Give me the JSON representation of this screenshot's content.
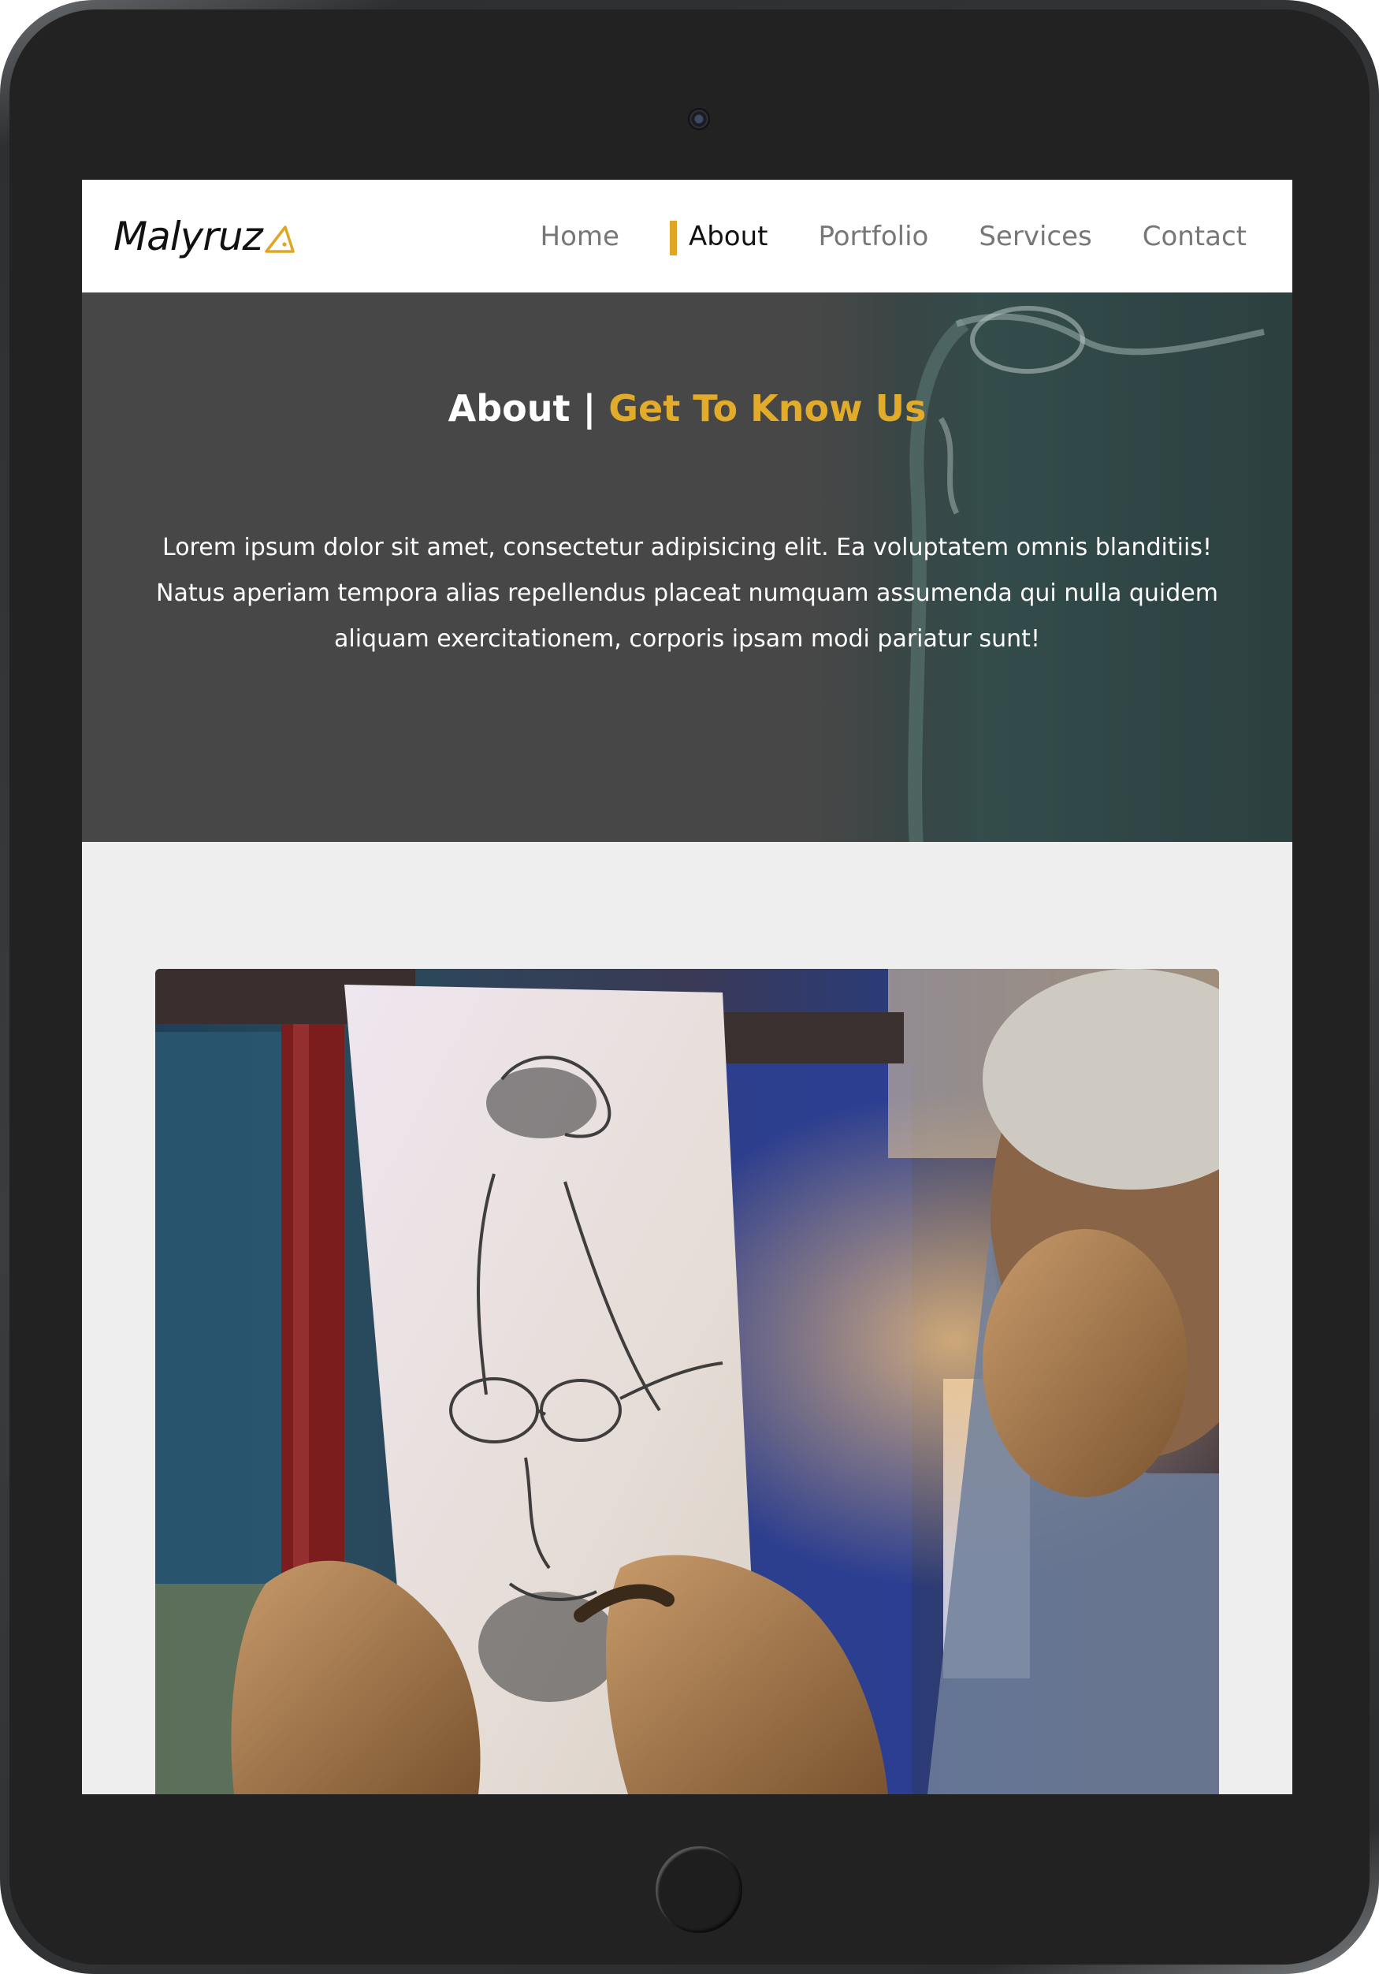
{
  "brand": {
    "name": "Malyruz",
    "logo_icon": "triangle-logo-icon",
    "accent_color": "#e0a521"
  },
  "nav": {
    "items": [
      {
        "label": "Home",
        "active": false
      },
      {
        "label": "About",
        "active": true
      },
      {
        "label": "Portfolio",
        "active": false
      },
      {
        "label": "Services",
        "active": false
      },
      {
        "label": "Contact",
        "active": false
      }
    ]
  },
  "hero": {
    "title_main": "About |",
    "title_accent": "Get To Know Us",
    "text": "Lorem ipsum dolor sit amet, consectetur adipisicing elit. Ea voluptatem omnis blanditiis! Natus aperiam tempora alias repellendus placeat numquam assumenda qui nulla quidem aliquam exercitationem, corporis ipsam modi pariatur sunt!",
    "background_color": "#474747"
  },
  "content": {
    "image": "artist-sketching-portrait-photo"
  },
  "device": {
    "frame_color": "#222222"
  }
}
